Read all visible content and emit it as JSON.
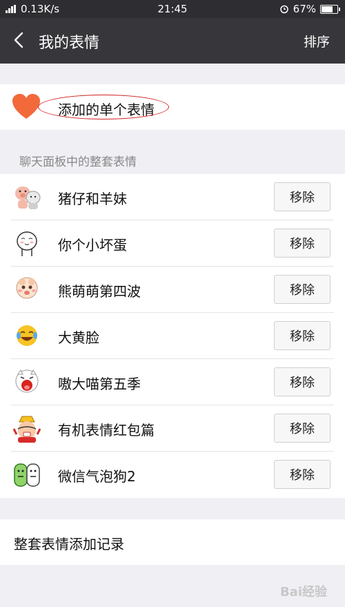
{
  "status_bar": {
    "network": "0.13K/s",
    "time": "21:45",
    "battery": "67%",
    "battery_level": 0.67
  },
  "header": {
    "title": "我的表情",
    "sort_label": "排序"
  },
  "single": {
    "label": "添加的单个表情"
  },
  "section": {
    "header": "聊天面板中的整套表情"
  },
  "sets": [
    {
      "name": "猪仔和羊妹",
      "remove": "移除",
      "icon": "pig-sticker-icon"
    },
    {
      "name": "你个小坏蛋",
      "remove": "移除",
      "icon": "face-sticker-icon"
    },
    {
      "name": "熊萌萌第四波",
      "remove": "移除",
      "icon": "baby-sticker-icon"
    },
    {
      "name": "大黄脸",
      "remove": "移除",
      "icon": "laughing-face-icon"
    },
    {
      "name": "嗷大喵第五季",
      "remove": "移除",
      "icon": "cat-sticker-icon"
    },
    {
      "name": "有机表情红包篇",
      "remove": "移除",
      "icon": "red-packet-sticker-icon"
    },
    {
      "name": "微信气泡狗2",
      "remove": "移除",
      "icon": "bubble-dog-sticker-icon"
    }
  ],
  "history": {
    "label": "整套表情添加记录"
  },
  "watermark": "Bai经验",
  "colors": {
    "header_bg": "#37373b",
    "status_bg": "#2e2e32",
    "heart": "#f26a3a",
    "annotation": "#d02020"
  }
}
